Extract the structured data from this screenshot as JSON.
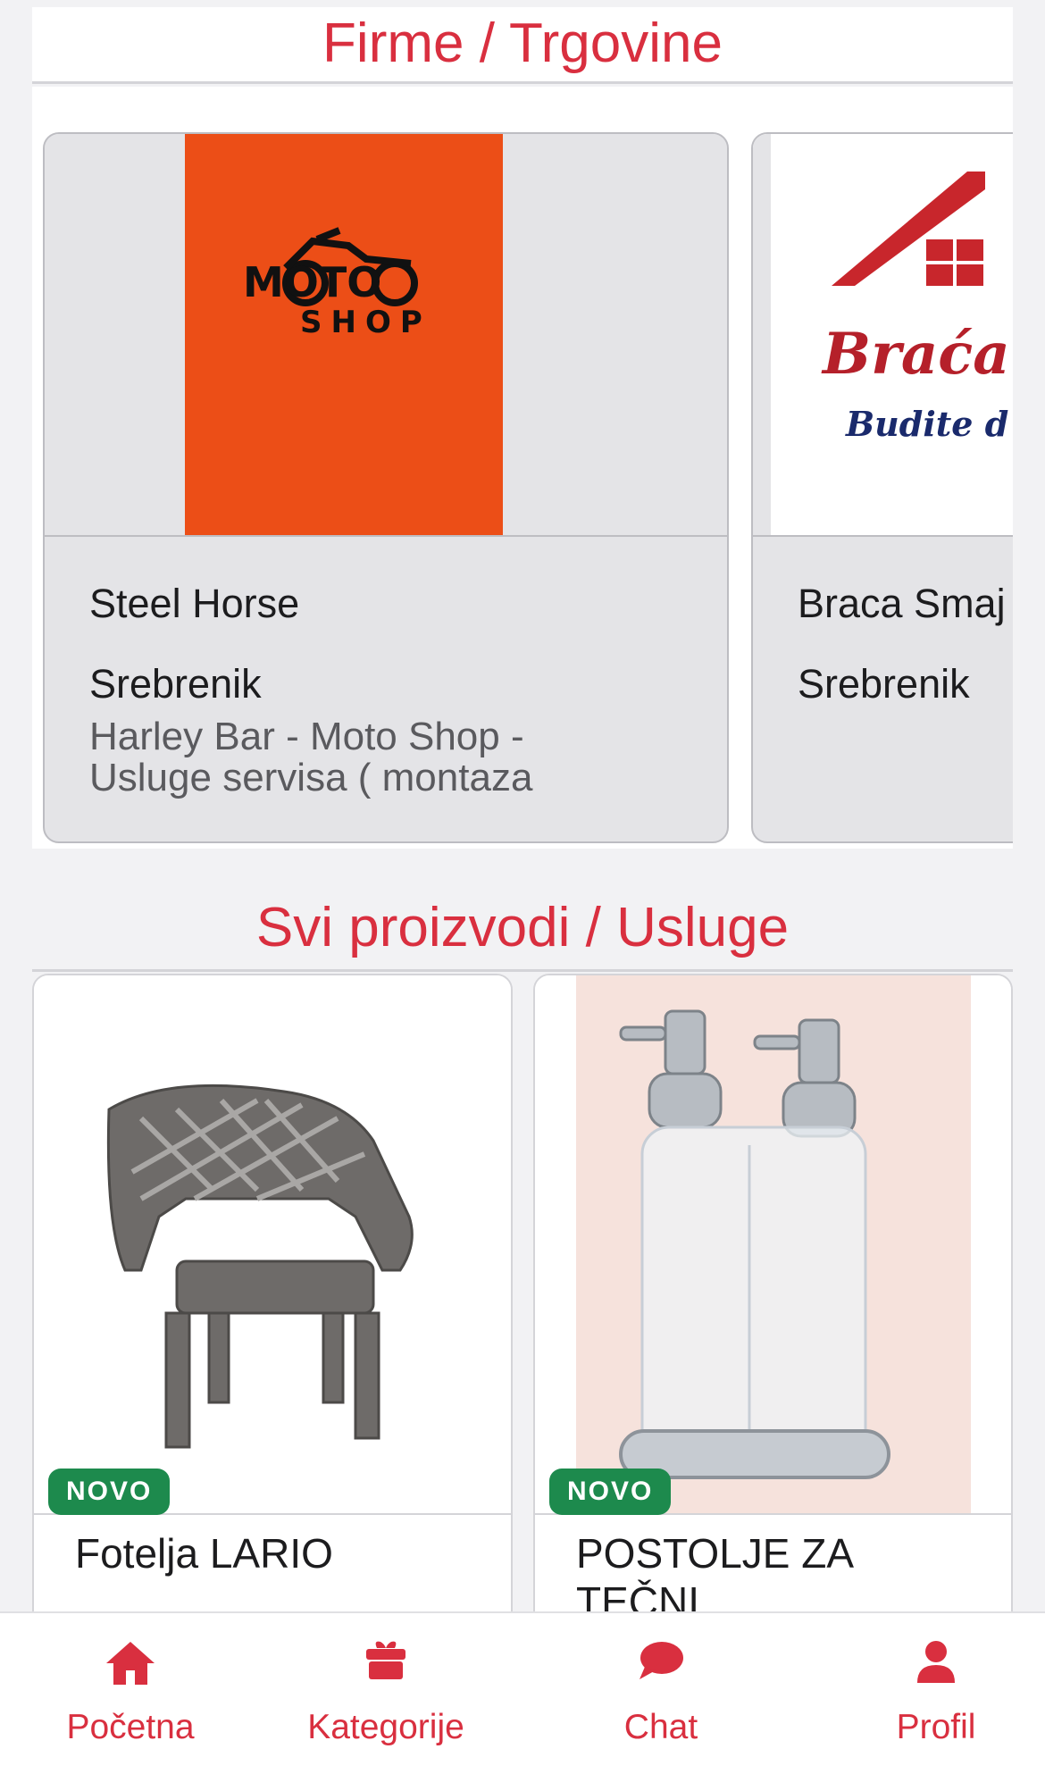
{
  "section_shops": {
    "title": "Firme / Trgovine"
  },
  "shops": [
    {
      "logo_text_top": "MOTO",
      "logo_text_bottom": "SHOP",
      "name": "Steel Horse",
      "city": "Srebrenik",
      "description": "Harley Bar - Moto Shop - Usluge servisa ( montaza"
    },
    {
      "logo_text_top": "Braća",
      "logo_text_bottom": "Budite d",
      "name": "Braca Smaj",
      "city": "Srebrenik",
      "description": ""
    }
  ],
  "section_products": {
    "title": "Svi proizvodi / Usluge"
  },
  "products": [
    {
      "badge": "NOVO",
      "title": "Fotelja LARIO"
    },
    {
      "badge": "NOVO",
      "title": "POSTOLJE ZA TEČNI"
    }
  ],
  "tabbar": {
    "items": [
      {
        "label": "Početna",
        "icon": "home-icon"
      },
      {
        "label": "Kategorije",
        "icon": "gift-box-icon"
      },
      {
        "label": "Chat",
        "icon": "chat-bubble-icon"
      },
      {
        "label": "Profil",
        "icon": "person-icon"
      }
    ]
  },
  "colors": {
    "accent": "#d92f3f",
    "badge": "#1d8a4d",
    "moto_logo_bg": "#ec4e17"
  }
}
